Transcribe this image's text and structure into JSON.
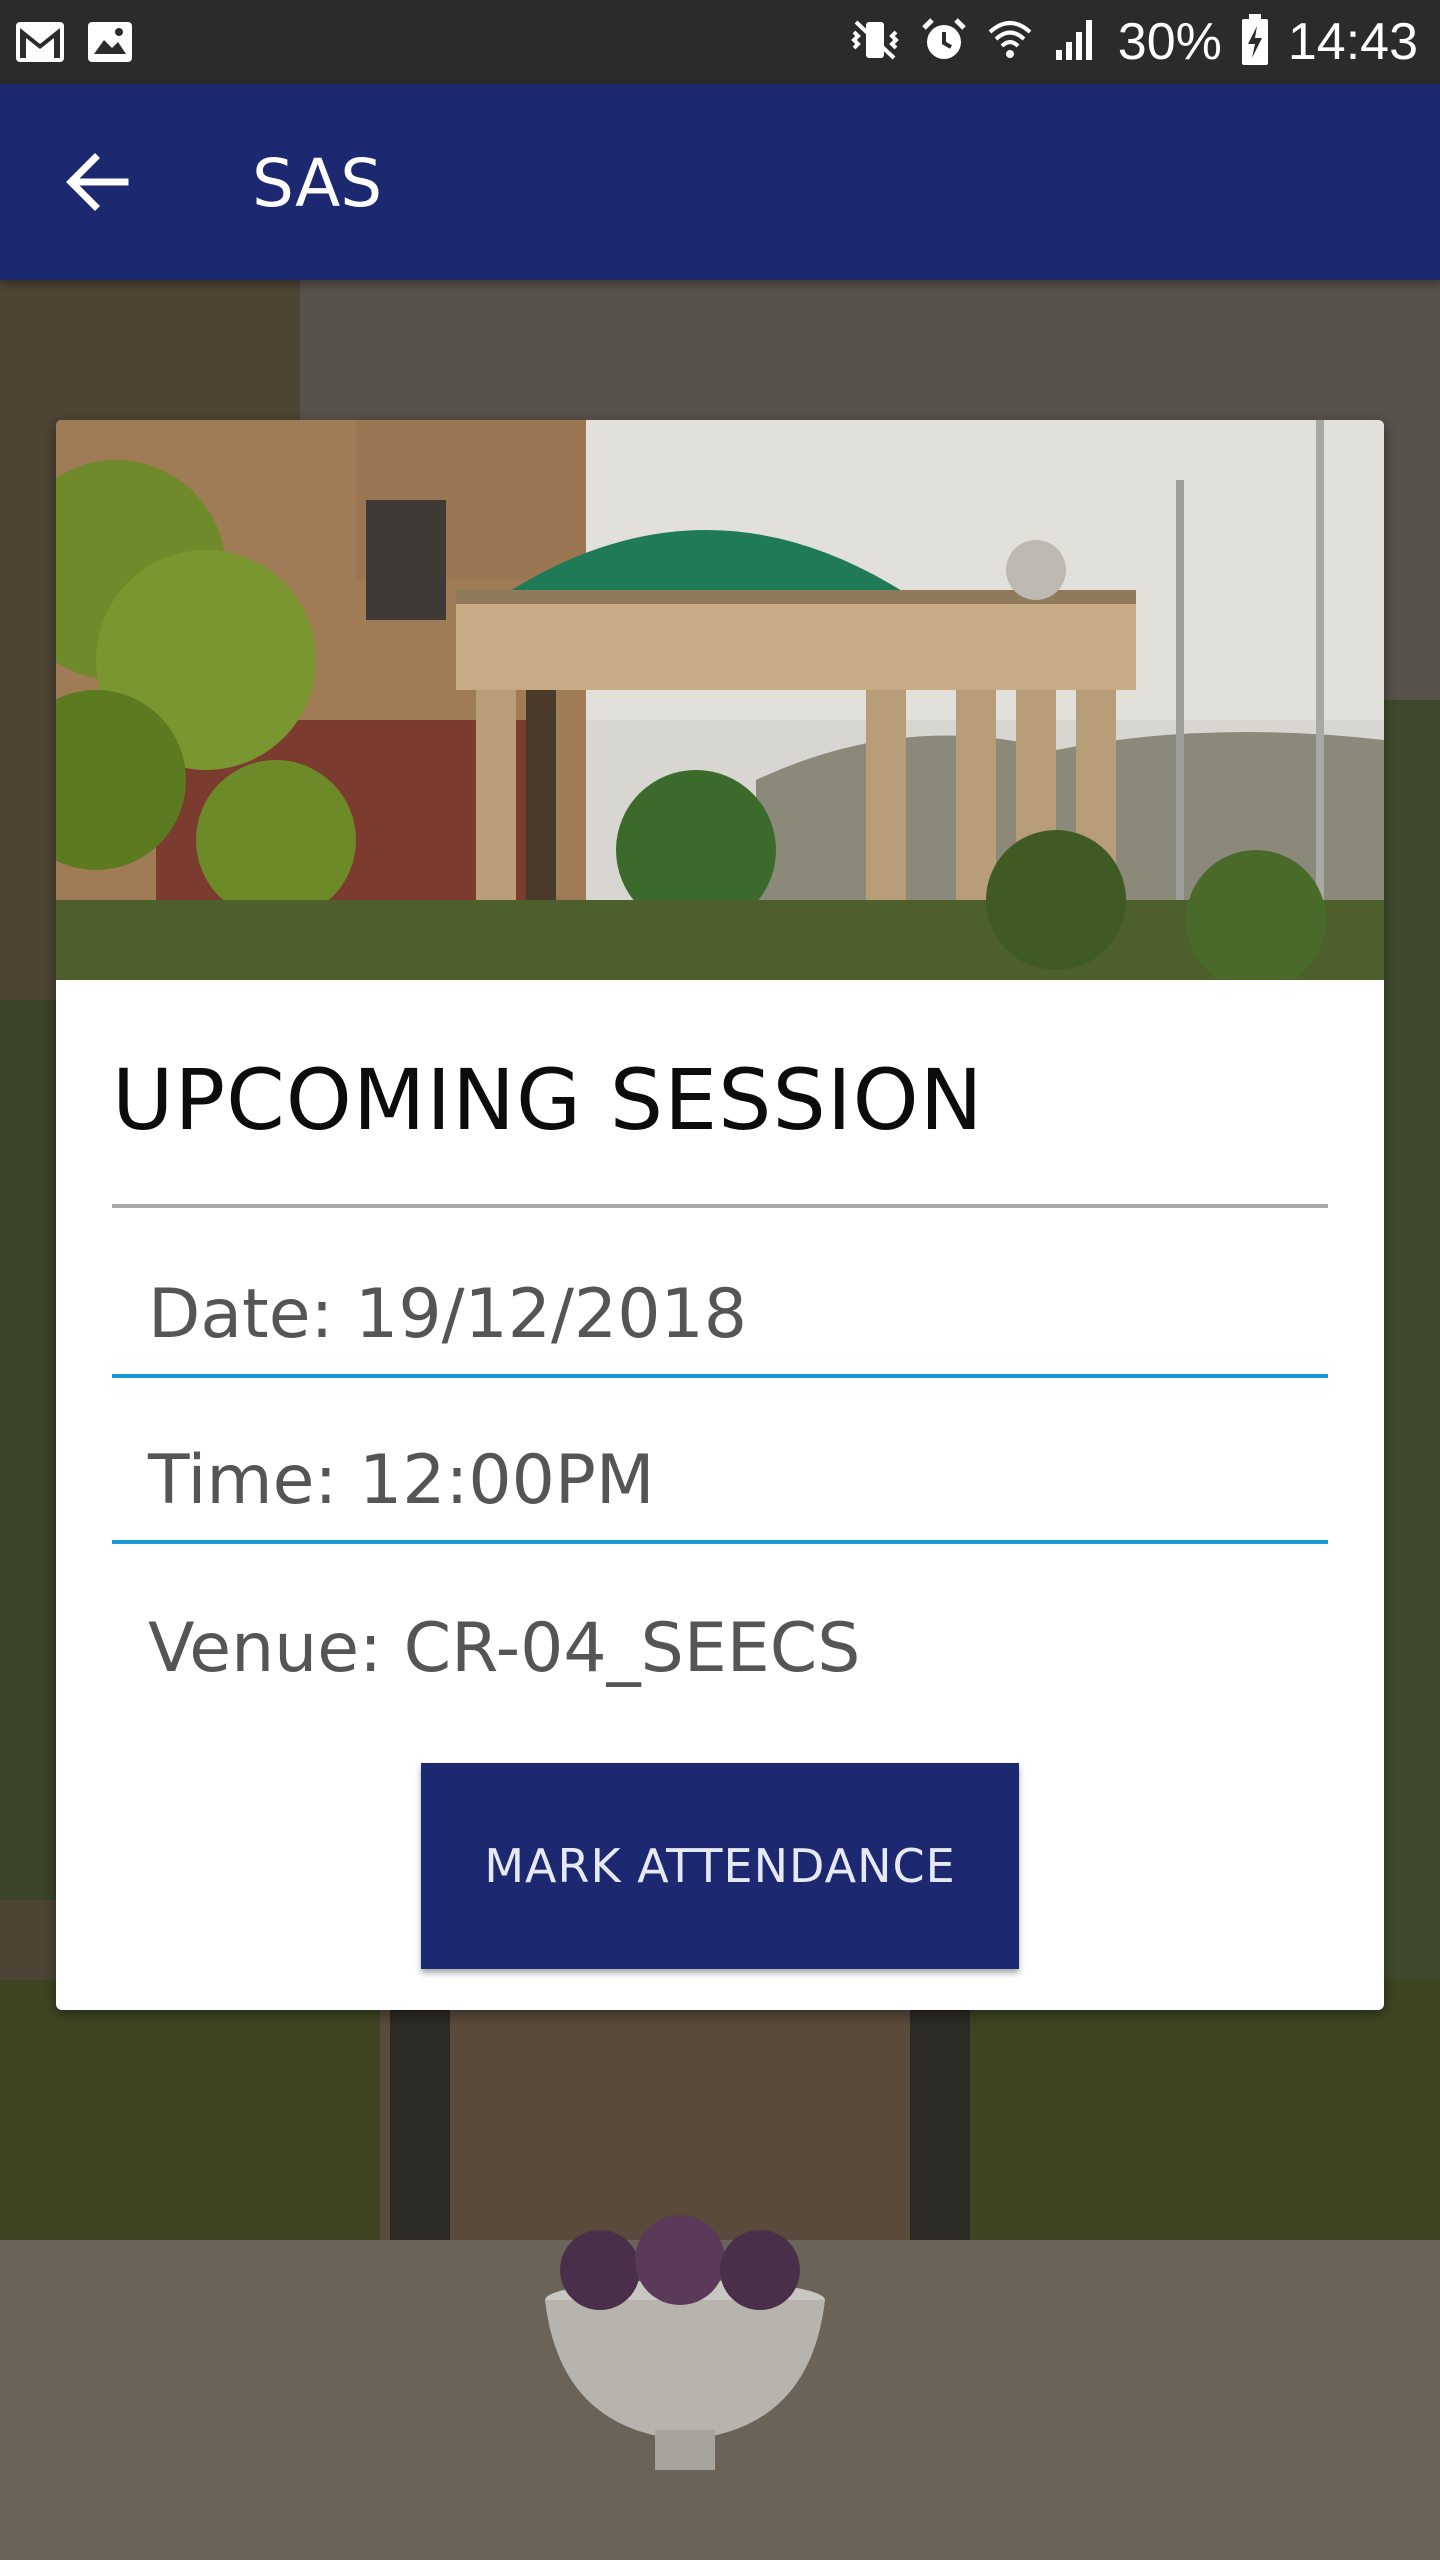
{
  "status_bar": {
    "battery": "30%",
    "time": "14:43",
    "icons": [
      "gmail-icon",
      "gallery-icon",
      "vibrate-icon",
      "alarm-icon",
      "wifi-icon",
      "signal-icon",
      "battery-charging-icon"
    ]
  },
  "app_bar": {
    "title": "SAS",
    "back_icon": "arrow-back-icon"
  },
  "card": {
    "title": "UPCOMING SESSION",
    "date": "Date: 19/12/2018",
    "time": "Time: 12:00PM",
    "venue": "Venue: CR-04_SEECS",
    "button_label": "MARK ATTENDANCE"
  },
  "colors": {
    "primary": "#1c2870",
    "status_bar": "#2b2b2b",
    "divider_accent": "#1a9ad8",
    "divider_grey": "#a8a8a8"
  }
}
